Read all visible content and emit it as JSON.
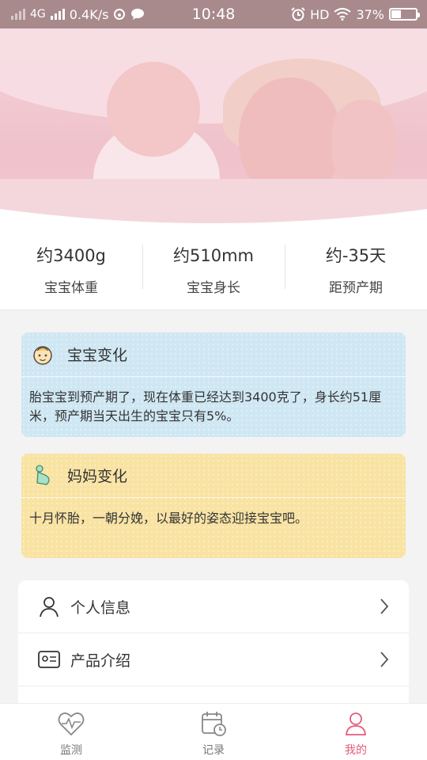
{
  "status_bar": {
    "network": "4G",
    "speed": "0.4K/s",
    "time": "10:48",
    "hd": "HD",
    "battery": "37%"
  },
  "stats": [
    {
      "value": "约3400g",
      "label": "宝宝体重"
    },
    {
      "value": "约510mm",
      "label": "宝宝身长"
    },
    {
      "value": "约-35天",
      "label": "距预产期"
    }
  ],
  "baby_card": {
    "title": "宝宝变化",
    "text": "胎宝宝到预产期了，现在体重已经达到3400克了，身长约51厘米，预产期当天出生的宝宝只有5%。",
    "color": "#cfe7f3",
    "icon": "baby-face-icon"
  },
  "mom_card": {
    "title": "妈妈变化",
    "text": "十月怀胎，一朝分娩，以最好的姿态迎接宝宝吧。",
    "color": "#f9e3a3",
    "icon": "pregnant-mother-icon"
  },
  "menu": [
    {
      "label": "个人信息",
      "icon": "person-icon"
    },
    {
      "label": "产品介绍",
      "icon": "id-card-icon"
    }
  ],
  "tabs": [
    {
      "label": "监测",
      "icon": "heart-monitor-icon",
      "active": false
    },
    {
      "label": "记录",
      "icon": "calendar-clock-icon",
      "active": false
    },
    {
      "label": "我的",
      "icon": "profile-icon",
      "active": true
    }
  ],
  "colors": {
    "accent": "#e65b7b",
    "status_bar": "#a88a8c"
  }
}
